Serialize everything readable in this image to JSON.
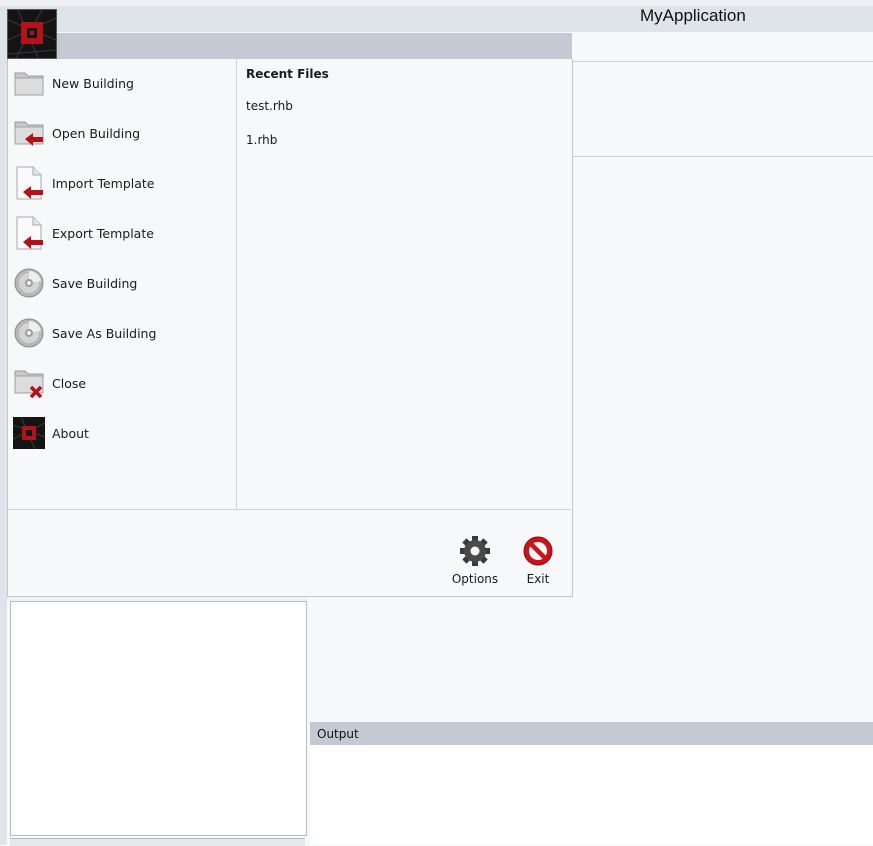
{
  "window": {
    "title": "MyApplication"
  },
  "backstage": {
    "items": [
      {
        "label": "New Building",
        "icon": "folder-icon"
      },
      {
        "label": "Open Building",
        "icon": "open-folder-icon"
      },
      {
        "label": "Import Template",
        "icon": "import-document-icon"
      },
      {
        "label": "Export Template",
        "icon": "export-document-icon"
      },
      {
        "label": "Save Building",
        "icon": "disc-icon"
      },
      {
        "label": "Save As Building",
        "icon": "disc-icon"
      },
      {
        "label": "Close",
        "icon": "close-folder-icon"
      },
      {
        "label": "About",
        "icon": "app-logo-icon"
      }
    ],
    "recent": {
      "title": "Recent Files",
      "files": [
        "test.rhb",
        "1.rhb"
      ]
    },
    "footer": {
      "options_label": "Options",
      "exit_label": "Exit"
    }
  },
  "panels": {
    "output_title": "Output"
  },
  "colors": {
    "accent_red": "#b3121b",
    "header_gray": "#c4c9d3",
    "background": "#f7f8fa"
  }
}
